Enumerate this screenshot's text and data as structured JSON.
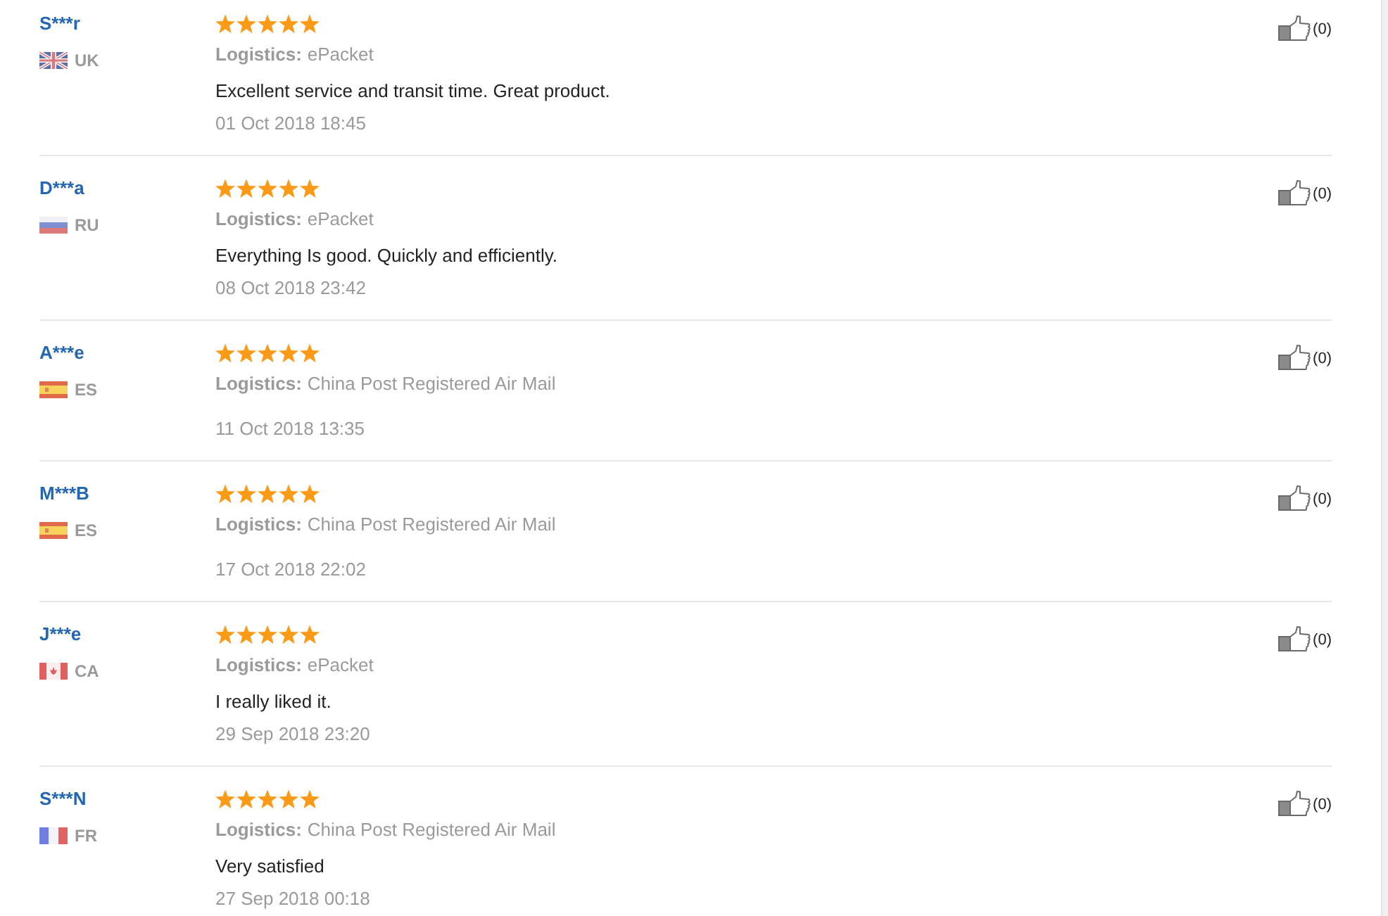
{
  "reviews": [
    {
      "name": "S***r",
      "flag": {
        "kind": "gb"
      },
      "country": "UK",
      "stars": 5,
      "logistics_label": "Logistics:",
      "logistics": "ePacket",
      "comment": "Excellent service and transit time. Great product.",
      "date": "01 Oct 2018 18:45",
      "likes": "(0)"
    },
    {
      "name": "D***a",
      "flag": {
        "kind": "ru"
      },
      "country": "RU",
      "stars": 5,
      "logistics_label": "Logistics:",
      "logistics": "ePacket",
      "comment": "Everything Is good. Quickly and efficiently.",
      "date": "08 Oct 2018 23:42",
      "likes": "(0)"
    },
    {
      "name": "A***e",
      "flag": {
        "kind": "es"
      },
      "country": "ES",
      "stars": 5,
      "logistics_label": "Logistics:",
      "logistics": "China Post Registered Air Mail",
      "date": "11 Oct 2018 13:35",
      "likes": "(0)"
    },
    {
      "name": "M***B",
      "flag": {
        "kind": "es"
      },
      "country": "ES",
      "stars": 5,
      "logistics_label": "Logistics:",
      "logistics": "China Post Registered Air Mail",
      "date": "17 Oct 2018 22:02",
      "likes": "(0)"
    },
    {
      "name": "J***e",
      "flag": {
        "kind": "ca"
      },
      "country": "CA",
      "stars": 5,
      "logistics_label": "Logistics:",
      "logistics": "ePacket",
      "comment": "I really liked it.",
      "date": "29 Sep 2018 23:20",
      "likes": "(0)"
    },
    {
      "name": "S***N",
      "flag": {
        "kind": "fr"
      },
      "country": "FR",
      "stars": 5,
      "logistics_label": "Logistics:",
      "logistics": "China Post Registered Air Mail",
      "comment": "Very satisfied",
      "date": "27 Sep 2018 00:18",
      "likes": "(0)"
    }
  ]
}
